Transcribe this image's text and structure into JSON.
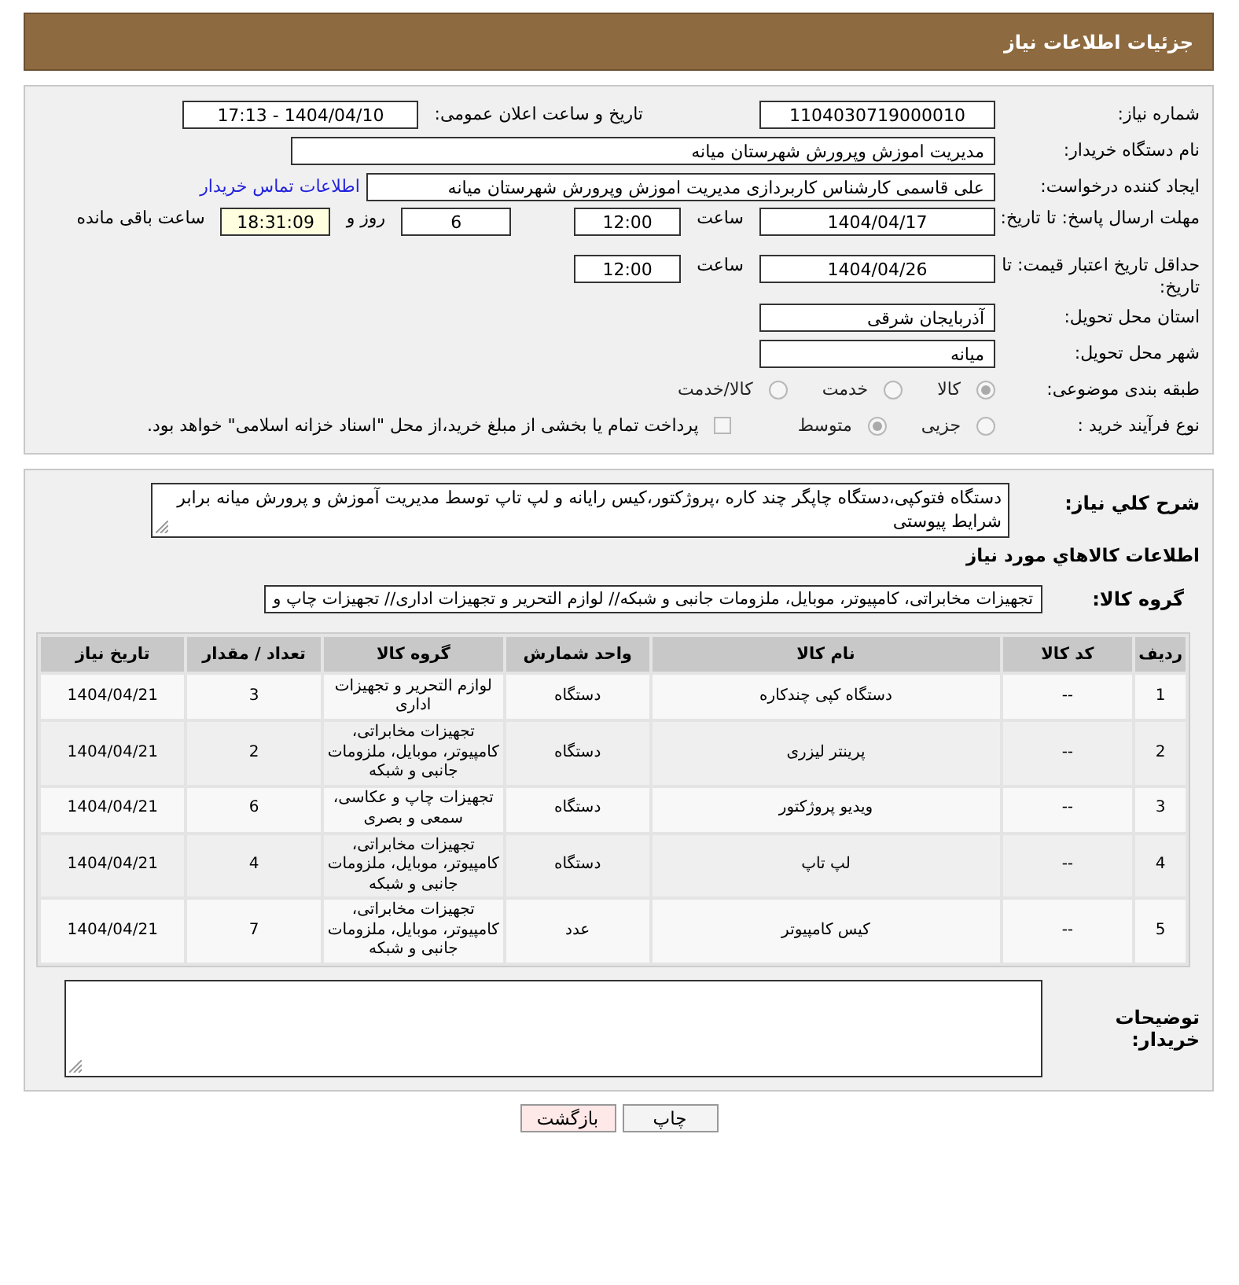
{
  "header": {
    "title": "جزئیات اطلاعات نیاز"
  },
  "details": {
    "need_number": {
      "label": "شماره نیاز:",
      "value": "1104030719000010"
    },
    "announce_datetime": {
      "label": "تاریخ و ساعت اعلان عمومی:",
      "value": "1404/04/10 - 17:13"
    },
    "buyer_org": {
      "label": "نام دستگاه خریدار:",
      "value": "مدیریت اموزش وپرورش شهرستان میانه"
    },
    "requester": {
      "label": "ایجاد کننده درخواست:",
      "value": "علی قاسمی کارشناس کاربردازی مدیریت اموزش وپرورش شهرستان میانه",
      "link": "اطلاعات تماس خریدار"
    },
    "reply_deadline": {
      "label": "مهلت ارسال پاسخ: تا تاریخ:",
      "date": "1404/04/17",
      "time_label": "ساعت",
      "time": "12:00",
      "days": "6",
      "days_label": "روز و",
      "remaining": "18:31:09",
      "remaining_label": "ساعت باقی مانده"
    },
    "price_validity": {
      "label": "حداقل تاریخ اعتبار قیمت: تا تاریخ:",
      "date": "1404/04/26",
      "time_label": "ساعت",
      "time": "12:00"
    },
    "province": {
      "label": "استان محل تحویل:",
      "value": "آذربایجان شرقی"
    },
    "city": {
      "label": "شهر محل تحویل:",
      "value": "میانه"
    },
    "classification": {
      "label": "طبقه بندی موضوعی:",
      "options": [
        {
          "label": "کالا",
          "selected": true
        },
        {
          "label": "خدمت",
          "selected": false
        },
        {
          "label": "کالا/خدمت",
          "selected": false
        }
      ]
    },
    "purchase_type": {
      "label": "نوع فرآیند خرید :",
      "options": [
        {
          "label": "جزیی",
          "selected": false
        },
        {
          "label": "متوسط",
          "selected": true
        }
      ],
      "treasury": {
        "label": "پرداخت تمام یا بخشی از مبلغ خرید،از محل \"اسناد خزانه اسلامی\" خواهد بود.",
        "checked": false
      }
    }
  },
  "description": {
    "label": "شرح کلي نیاز:",
    "value": "دستگاه فتوکپی،دستگاه چاپگر چند کاره ،پروژکتور،کیس رایانه و لپ تاپ  توسط مدیریت آموزش و پرورش میانه برابر شرایط پیوستی"
  },
  "goods": {
    "heading": "اطلاعات کالاهاي مورد نیاز",
    "group_label": "گروه کالا:",
    "group_value": "تجهیزات مخابراتی، کامپیوتر، موبایل، ملزومات جانبی و شبکه// لوازم التحریر و تجهیزات اداری// تجهیزات چاپ و",
    "table": {
      "columns": [
        "ردیف",
        "کد کالا",
        "نام کالا",
        "واحد شمارش",
        "گروه کالا",
        "تعداد / مقدار",
        "تاریخ نیاز"
      ],
      "rows": [
        [
          "1",
          "--",
          "دستگاه کپی چندکاره",
          "دستگاه",
          "لوازم التحریر و تجهیزات اداری",
          "3",
          "1404/04/21"
        ],
        [
          "2",
          "--",
          "پرینتر لیزری",
          "دستگاه",
          "تجهیزات مخابراتی، کامپیوتر، موبایل، ملزومات جانبی و شبکه",
          "2",
          "1404/04/21"
        ],
        [
          "3",
          "--",
          "ویدیو پروژکتور",
          "دستگاه",
          "تجهیزات چاپ و عکاسی، سمعی و بصری",
          "6",
          "1404/04/21"
        ],
        [
          "4",
          "--",
          "لپ تاپ",
          "دستگاه",
          "تجهیزات مخابراتی، کامپیوتر، موبایل، ملزومات جانبی و شبکه",
          "4",
          "1404/04/21"
        ],
        [
          "5",
          "--",
          "کیس کامپیوتر",
          "عدد",
          "تجهیزات مخابراتی، کامپیوتر، موبایل، ملزومات جانبی و شبکه",
          "7",
          "1404/04/21"
        ]
      ]
    }
  },
  "buyer_notes": {
    "label": "توضیحات خریدار:"
  },
  "buttons": [
    {
      "label": "چاپ",
      "kind": "print"
    },
    {
      "label": "بازگشت",
      "kind": "back"
    }
  ]
}
